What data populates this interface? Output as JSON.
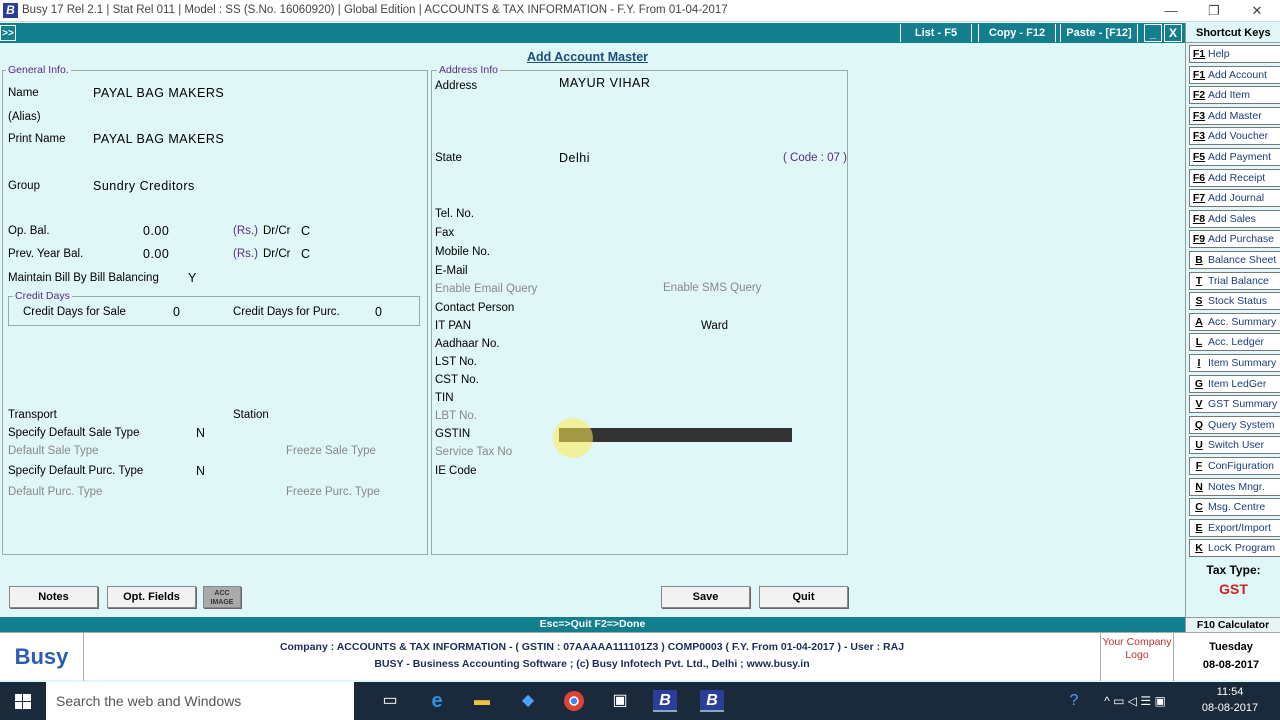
{
  "window": {
    "title": "Busy 17  Rel 2.1  |  Stat Rel 011  |  Model : SS (S.No. 16060920)  |  Global Edition  |  ACCOUNTS & TAX INFORMATION - F.Y. From 01-04-2017",
    "minimize": "—",
    "maximize": "❐",
    "close": "✕"
  },
  "toolbar": {
    "expand": ">>",
    "list": "List - F5",
    "copy": "Copy - F12",
    "paste": "Paste - [F12]",
    "min": "_",
    "close": "X"
  },
  "form": {
    "title": "Add Account Master",
    "general_legend": "General Info.",
    "name_label": "Name",
    "name_value": "PAYAL BAG MAKERS",
    "alias_label": "(Alias)",
    "print_name_label": "Print Name",
    "print_name_value": "PAYAL BAG MAKERS",
    "group_label": "Group",
    "group_value": "Sundry Creditors",
    "op_bal_label": "Op. Bal.",
    "op_bal_value": "0.00",
    "op_bal_unit": "(Rs.)",
    "op_drcr_label": "Dr/Cr",
    "op_drcr_value": "C",
    "prev_bal_label": "Prev. Year Bal.",
    "prev_bal_value": "0.00",
    "prev_bal_unit": "(Rs.)",
    "prev_drcr_label": "Dr/Cr",
    "prev_drcr_value": "C",
    "bill_bal_label": "Maintain Bill By Bill Balancing",
    "bill_bal_value": "Y",
    "credit_legend": "Credit Days",
    "cd_sale_label": "Credit Days for Sale",
    "cd_sale_value": "0",
    "cd_purc_label": "Credit Days for Purc.",
    "cd_purc_value": "0",
    "transport_label": "Transport",
    "station_label": "Station",
    "def_sale_type_label": "Specify Default Sale Type",
    "def_sale_type_value": "N",
    "default_sale_label": "Default Sale Type",
    "freeze_sale_label": "Freeze Sale Type",
    "def_purc_type_label": "Specify Default Purc. Type",
    "def_purc_type_value": "N",
    "default_purc_label": "Default Purc. Type",
    "freeze_purc_label": "Freeze Purc. Type",
    "address_legend": "Address Info",
    "address_label": "Address",
    "address_value": "MAYUR VIHAR",
    "state_label": "State",
    "state_value": "Delhi",
    "state_code": "( Code : 07 )",
    "tel_label": "Tel. No.",
    "fax_label": "Fax",
    "mobile_label": "Mobile No.",
    "email_label": "E-Mail",
    "email_query_label": "Enable Email Query",
    "sms_query_label": "Enable SMS Query",
    "contact_label": "Contact Person",
    "itpan_label": "IT PAN",
    "ward_label": "Ward",
    "aadhaar_label": "Aadhaar No.",
    "lst_label": "LST No.",
    "cst_label": "CST No.",
    "tin_label": "TIN",
    "lbt_label": "LBT No.",
    "gstin_label": "GSTIN",
    "service_tax_label": "Service Tax No",
    "ie_code_label": "IE Code",
    "notes_btn": "Notes",
    "opt_fields_btn": "Opt. Fields",
    "acc_image_btn": "ACC IMAGE",
    "save_btn": "Save",
    "quit_btn": "Quit"
  },
  "shortcuts": {
    "title": "Shortcut Keys",
    "items": [
      {
        "key": "F1",
        "label": "Help"
      },
      {
        "key": "F1",
        "label": "Add Account"
      },
      {
        "key": "F2",
        "label": "Add Item"
      },
      {
        "key": "F3",
        "label": "Add Master"
      },
      {
        "key": "F3",
        "label": "Add Voucher"
      },
      {
        "key": "F5",
        "label": "Add Payment"
      },
      {
        "key": "F6",
        "label": "Add Receipt"
      },
      {
        "key": "F7",
        "label": "Add Journal"
      },
      {
        "key": "F8",
        "label": "Add Sales"
      },
      {
        "key": "F9",
        "label": "Add Purchase"
      },
      {
        "key": "B",
        "label": "Balance Sheet"
      },
      {
        "key": "T",
        "label": "Trial Balance"
      },
      {
        "key": "S",
        "label": "Stock Status"
      },
      {
        "key": "A",
        "label": "Acc. Summary"
      },
      {
        "key": "L",
        "label": "Acc. Ledger"
      },
      {
        "key": "I",
        "label": "Item Summary"
      },
      {
        "key": "G",
        "label": "Item LedGer"
      },
      {
        "key": "V",
        "label": "GST Summary"
      },
      {
        "key": "Q",
        "label": "Query System"
      },
      {
        "key": "U",
        "label": "Switch User"
      },
      {
        "key": "F",
        "label": "ConFiguration"
      },
      {
        "key": "N",
        "label": "Notes Mngr."
      },
      {
        "key": "C",
        "label": "Msg. Centre"
      },
      {
        "key": "E",
        "label": "Export/Import"
      },
      {
        "key": "K",
        "label": "LocK Program"
      }
    ],
    "tax_type_label": "Tax Type:",
    "tax_type_value": "GST"
  },
  "status": {
    "hint": "Esc=>Quit    F2=>Done",
    "calculator": "F10 Calculator"
  },
  "footer": {
    "brand": "Busy",
    "line1": "Company : ACCOUNTS & TAX INFORMATION - ( GSTIN : 07AAAAA111101Z3 ) COMP0003 ( F.Y. From 01-04-2017 ) - User : RAJ",
    "line2": "BUSY - Business Accounting Software  ;  (c) Busy Infotech Pvt. Ltd., Delhi  ;  www.busy.in",
    "company_logo": "Your Company Logo",
    "day": "Tuesday",
    "date": "08-08-2017"
  },
  "taskbar": {
    "search_placeholder": "Search the web and Windows",
    "time": "11:54",
    "date": "08-08-2017"
  },
  "colors": {
    "accent": "#127e8e",
    "form_bg": "#dff7f7",
    "tax_type": "#d02020"
  }
}
